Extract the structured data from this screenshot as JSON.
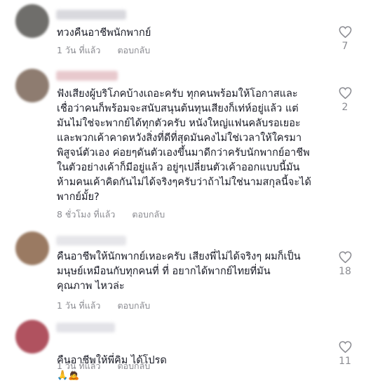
{
  "comments": [
    {
      "text": "ทวงคืนอาชีพนักพากย์",
      "time": "1 วัน ที่แล้ว",
      "reply": "ตอบกลับ",
      "likes": "7",
      "avatar_color": "#6f6e6b",
      "name_color": "#d9d9de"
    },
    {
      "text": "ฟังเสียงผู้บริโภคบ้างเถอะครับ ทุกคนพร้อมให้โอกาสและ\nเชื่อว่าคนก็พร้อมจะสนับสนุนต้นทุนเสียงก็เท่ห์อยู่แล้ว แต่\nมันไม่ใช่จะพากย์ได้ทุกตัวครับ หนังใหญ่แฟนคลับรอเยอะ\nและพวกเค้าคาดหวังสิ่งที่ดีที่สุดมันคงไม่ใช่เวลาให้ใครมา\nพิสูจน์ตัวเอง ค่อยๆดันตัวเองขึ้นมาดีกว่าครับนักพากย์อาชีพ\nในตัวอย่างเค้าก็มีอยู่แล้ว อยู่ๆเปลี่ยนตัวเค้าออกแบบนี้มัน\nห้ามคนเค้าคิดกันไม่ได้จริงๆครับว่าถ้าไม่ใช่นามสกุลนี้จะได้\nพากย์มั้ย?",
      "time": "8 ชั่วโมง ที่แล้ว",
      "reply": "ตอบกลับ",
      "likes": "2",
      "avatar_color": "#8e7c70",
      "name_color": "#e8c9cd"
    },
    {
      "text": "คืนอาชีพให้นักพากย์เหอะครับ เสียงพี่ไม่ได้จริงๆ ผมก็เป็น\nมนุษย์เหมือนกับทุกคนที่ ที่ อยากได้พากย์ไทยที่มัน\nคุณภาพ ไหวล่ะ",
      "time": "1 วัน ที่แล้ว",
      "reply": "ตอบกลับ",
      "likes": "18",
      "avatar_color": "#9a7a62",
      "name_color": "#e6e6ea"
    },
    {
      "text": "คืนอาชีพให้พี่คิม ได้โปรด",
      "emoji": "🙏🙇",
      "time": "1 วัน ที่แล้ว",
      "reply": "ตอบกลับ",
      "likes": "11",
      "avatar_color": "#b0525f",
      "name_color": "#e3e3e8"
    }
  ]
}
